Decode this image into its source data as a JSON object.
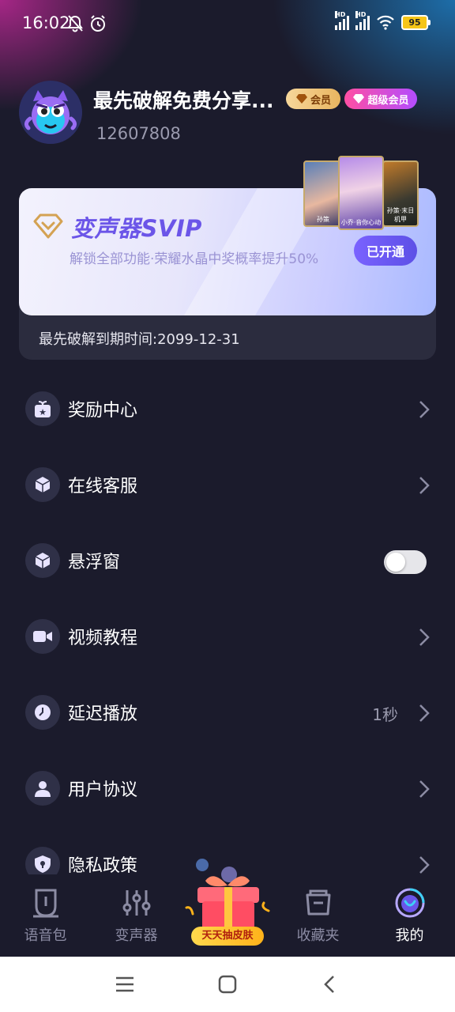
{
  "status_bar": {
    "time": "16:02",
    "battery": "95",
    "signal_1": "HD",
    "signal_2": "HD"
  },
  "profile": {
    "username": "最先破解免费分享...",
    "user_id": "12607808",
    "badge_member": "会员",
    "badge_super": "超级会员"
  },
  "vip": {
    "title": "变声器SVIP",
    "description": "解锁全部功能·荣耀水晶中奖概率提升50%",
    "button_label": "已开通",
    "expire_text": "最先破解到期时间:2099-12-31",
    "skins": [
      "孙策",
      "小乔·音你心动",
      "孙策·末日机甲"
    ]
  },
  "menu": [
    {
      "label": "奖励中心",
      "icon": "gift-box-icon",
      "type": "chevron"
    },
    {
      "label": "在线客服",
      "icon": "cube-icon",
      "type": "chevron"
    },
    {
      "label": "悬浮窗",
      "icon": "cube-icon",
      "type": "toggle",
      "enabled": false
    },
    {
      "label": "视频教程",
      "icon": "video-camera-icon",
      "type": "chevron"
    },
    {
      "label": "延迟播放",
      "icon": "clock-icon",
      "type": "chevron",
      "value": "1秒"
    },
    {
      "label": "用户协议",
      "icon": "user-icon",
      "type": "chevron"
    },
    {
      "label": "隐私政策",
      "icon": "shield-lock-icon",
      "type": "chevron"
    }
  ],
  "tabs": [
    {
      "label": "语音包",
      "icon": "voice-pack-icon",
      "active": false
    },
    {
      "label": "变声器",
      "icon": "equalizer-icon",
      "active": false
    },
    {
      "label": "天天抽皮肤",
      "icon": "gift-icon",
      "active": false
    },
    {
      "label": "收藏夹",
      "icon": "folder-icon",
      "active": false
    },
    {
      "label": "我的",
      "icon": "profile-icon",
      "active": true
    }
  ],
  "colors": {
    "background": "#1b1b2c",
    "accent": "#6b55e8",
    "muted_text": "#9a9aae"
  }
}
